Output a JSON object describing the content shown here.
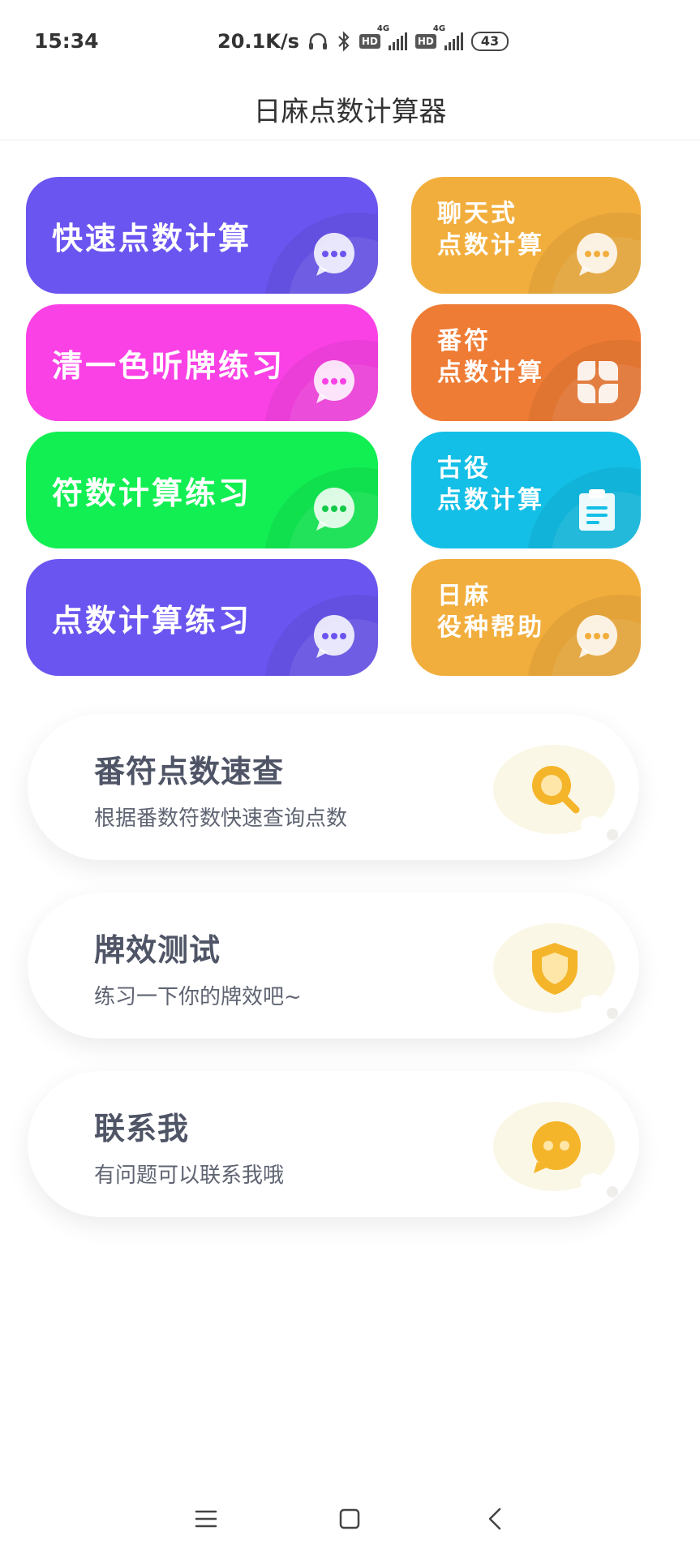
{
  "status_bar": {
    "time": "15:34",
    "speed": "20.1K/s",
    "hd1": "HD",
    "hd2": "HD",
    "net1": "4G",
    "net2": "4G",
    "battery": "43"
  },
  "header": {
    "title": "日麻点数计算器"
  },
  "grid": {
    "left": [
      {
        "label": "快速点数计算",
        "color": "#6a55f0",
        "icon": "chat-bubble-icon"
      },
      {
        "label": "清一色听牌练习",
        "color": "#fa41e5",
        "icon": "chat-bubble-icon"
      },
      {
        "label": "符数计算练习",
        "color": "#12ef53",
        "icon": "chat-bubble-icon"
      },
      {
        "label": "点数计算练习",
        "color": "#6a55f0",
        "icon": "chat-bubble-icon"
      }
    ],
    "right": [
      {
        "label": "聊天式\n点数计算",
        "color": "#f2ae3d",
        "icon": "chat-bubble-icon"
      },
      {
        "label": "番符\n点数计算",
        "color": "#ee7c35",
        "icon": "four-petal-grid-icon"
      },
      {
        "label": "古役\n点数计算",
        "color": "#13bfe6",
        "icon": "clipboard-icon"
      },
      {
        "label": "日麻\n役种帮助",
        "color": "#f2ae3d",
        "icon": "chat-bubble-icon"
      }
    ]
  },
  "cards": [
    {
      "title": "番符点数速查",
      "subtitle": "根据番数符数快速查询点数",
      "icon": "search-icon"
    },
    {
      "title": "牌效测试",
      "subtitle": "练习一下你的牌效吧~",
      "icon": "shield-icon"
    },
    {
      "title": "联系我",
      "subtitle": "有问题可以联系我哦",
      "icon": "message-icon"
    }
  ],
  "colors": {
    "icon_yellow": "#f5b52a",
    "card_title": "#4f5566",
    "card_sub": "#5f6472"
  },
  "nav": {
    "menu_icon": "menu-icon",
    "home_icon": "home-square-icon",
    "back_icon": "back-chevron-icon"
  }
}
